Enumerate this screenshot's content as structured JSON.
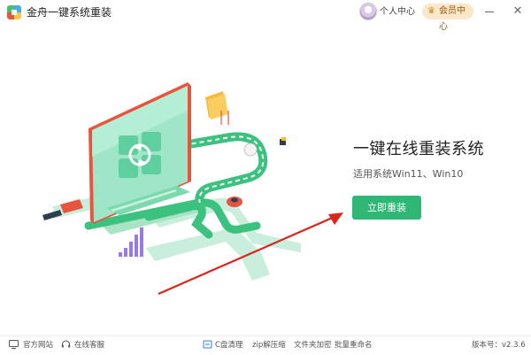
{
  "titlebar": {
    "app_title": "金舟一键系统重装",
    "user_center": "个人中心",
    "vip_center": "会员中心",
    "minimize_icon": "minimize-icon",
    "close_icon": "close-icon"
  },
  "hero": {
    "headline": "一键在线重装系统",
    "subline": "适用系统Win11、Win10",
    "reinstall_button": "立即重装"
  },
  "footer": {
    "official_site": "官方网站",
    "online_support": "在线客服",
    "c_drive_clean": "C盘清理",
    "zip_tool": "zip解压缩",
    "folder_encrypt": "文件夹加密",
    "batch_rename": "批量重命名",
    "version": "版本号：v2.3.6"
  },
  "colors": {
    "accent_green": "#2fb776",
    "vip_bg": "#fbe7c9",
    "arrow_red": "#d9251c"
  }
}
